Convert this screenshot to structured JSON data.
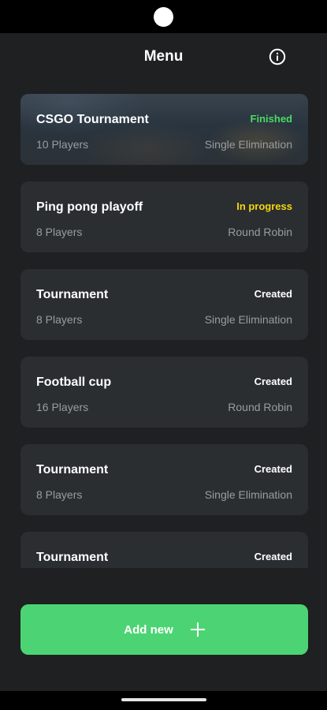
{
  "header": {
    "title": "Menu",
    "info_icon": "info-circle-icon"
  },
  "tournaments": [
    {
      "name": "CSGO Tournament",
      "status": "Finished",
      "players": "10 Players",
      "format": "Single Elimination"
    },
    {
      "name": "Ping pong playoff",
      "status": "In progress",
      "players": "8 Players",
      "format": "Round Robin"
    },
    {
      "name": "Tournament",
      "status": "Created",
      "players": "8 Players",
      "format": "Single Elimination"
    },
    {
      "name": "Football cup",
      "status": "Created",
      "players": "16 Players",
      "format": "Round Robin"
    },
    {
      "name": "Tournament",
      "status": "Created",
      "players": "8 Players",
      "format": "Single Elimination"
    },
    {
      "name": "Tournament",
      "status": "Created",
      "players": "",
      "format": ""
    }
  ],
  "add_button": {
    "label": "Add new",
    "icon": "plus-icon"
  },
  "colors": {
    "background": "#1e2022",
    "card": "#2a2e31",
    "accent_green": "#4cd474",
    "status_finished": "#4cd964",
    "status_in_progress": "#f5d60a",
    "status_created": "#ffffff",
    "secondary_text": "#9a9da0"
  }
}
